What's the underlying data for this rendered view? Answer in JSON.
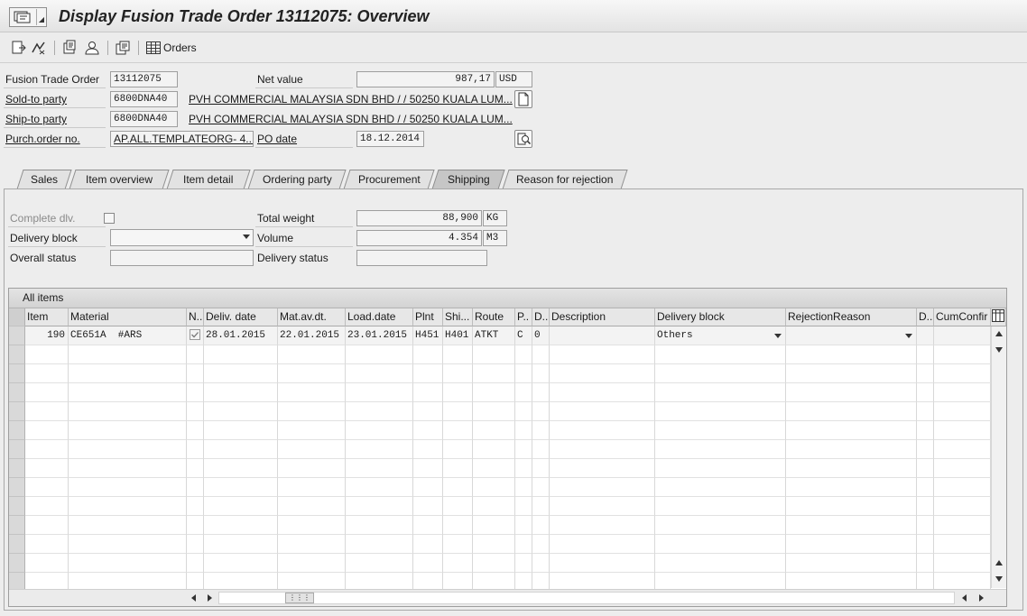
{
  "window": {
    "title": "Display Fusion Trade Order 13112075: Overview"
  },
  "toolbar": {
    "orders_label": "Orders"
  },
  "header": {
    "order_label": "Fusion Trade Order",
    "order_value": "13112075",
    "net_value_label": "Net value",
    "net_value": "987,17",
    "currency": "USD",
    "sold_to_label": "Sold-to party",
    "sold_to_value": "6800DNA40",
    "sold_to_name": "PVH COMMERCIAL MALAYSIA SDN BHD / / 50250 KUALA LUM...",
    "ship_to_label": "Ship-to party",
    "ship_to_value": "6800DNA40",
    "ship_to_name": "PVH COMMERCIAL MALAYSIA SDN BHD / / 50250 KUALA LUM...",
    "po_label": "Purch.order no.",
    "po_value": "AP.ALL.TEMPLATEORG- 4...",
    "po_date_label": "PO date",
    "po_date_value": "18.12.2014"
  },
  "tabs": [
    {
      "label": "Sales"
    },
    {
      "label": "Item overview"
    },
    {
      "label": "Item detail"
    },
    {
      "label": "Ordering party"
    },
    {
      "label": "Procurement"
    },
    {
      "label": "Shipping",
      "active": true
    },
    {
      "label": "Reason for rejection"
    }
  ],
  "shipping": {
    "complete_dlv_label": "Complete dlv.",
    "complete_dlv_checked": false,
    "delivery_block_label": "Delivery block",
    "delivery_block_value": "",
    "overall_status_label": "Overall status",
    "overall_status_value": "",
    "total_weight_label": "Total weight",
    "total_weight_value": "88,900",
    "total_weight_unit": "KG",
    "volume_label": "Volume",
    "volume_value": "4.354",
    "volume_unit": "M3",
    "delivery_status_label": "Delivery status",
    "delivery_status_value": ""
  },
  "grid": {
    "title": "All items",
    "columns": [
      "Item",
      "Material",
      "N..",
      "Deliv. date",
      "Mat.av.dt.",
      "Load.date",
      "Plnt",
      "Shi...",
      "Route",
      "P..",
      "D..",
      "Description",
      "Delivery block",
      "RejectionReason",
      "D..",
      "CumConfir"
    ],
    "rows": [
      {
        "item": "190",
        "material": "CE651A  #ARS",
        "n_checked": true,
        "deliv_date": "28.01.2015",
        "mat_av_dt": "22.01.2015",
        "load_date": "23.01.2015",
        "plnt": "H451",
        "shipping_point": "H401",
        "route": "ATKT",
        "p": "C",
        "d": "0",
        "description": "",
        "delivery_block": "Others",
        "rejection_reason": "",
        "d2": "",
        "cum_confirmed": ""
      }
    ],
    "empty_rows": 13
  }
}
